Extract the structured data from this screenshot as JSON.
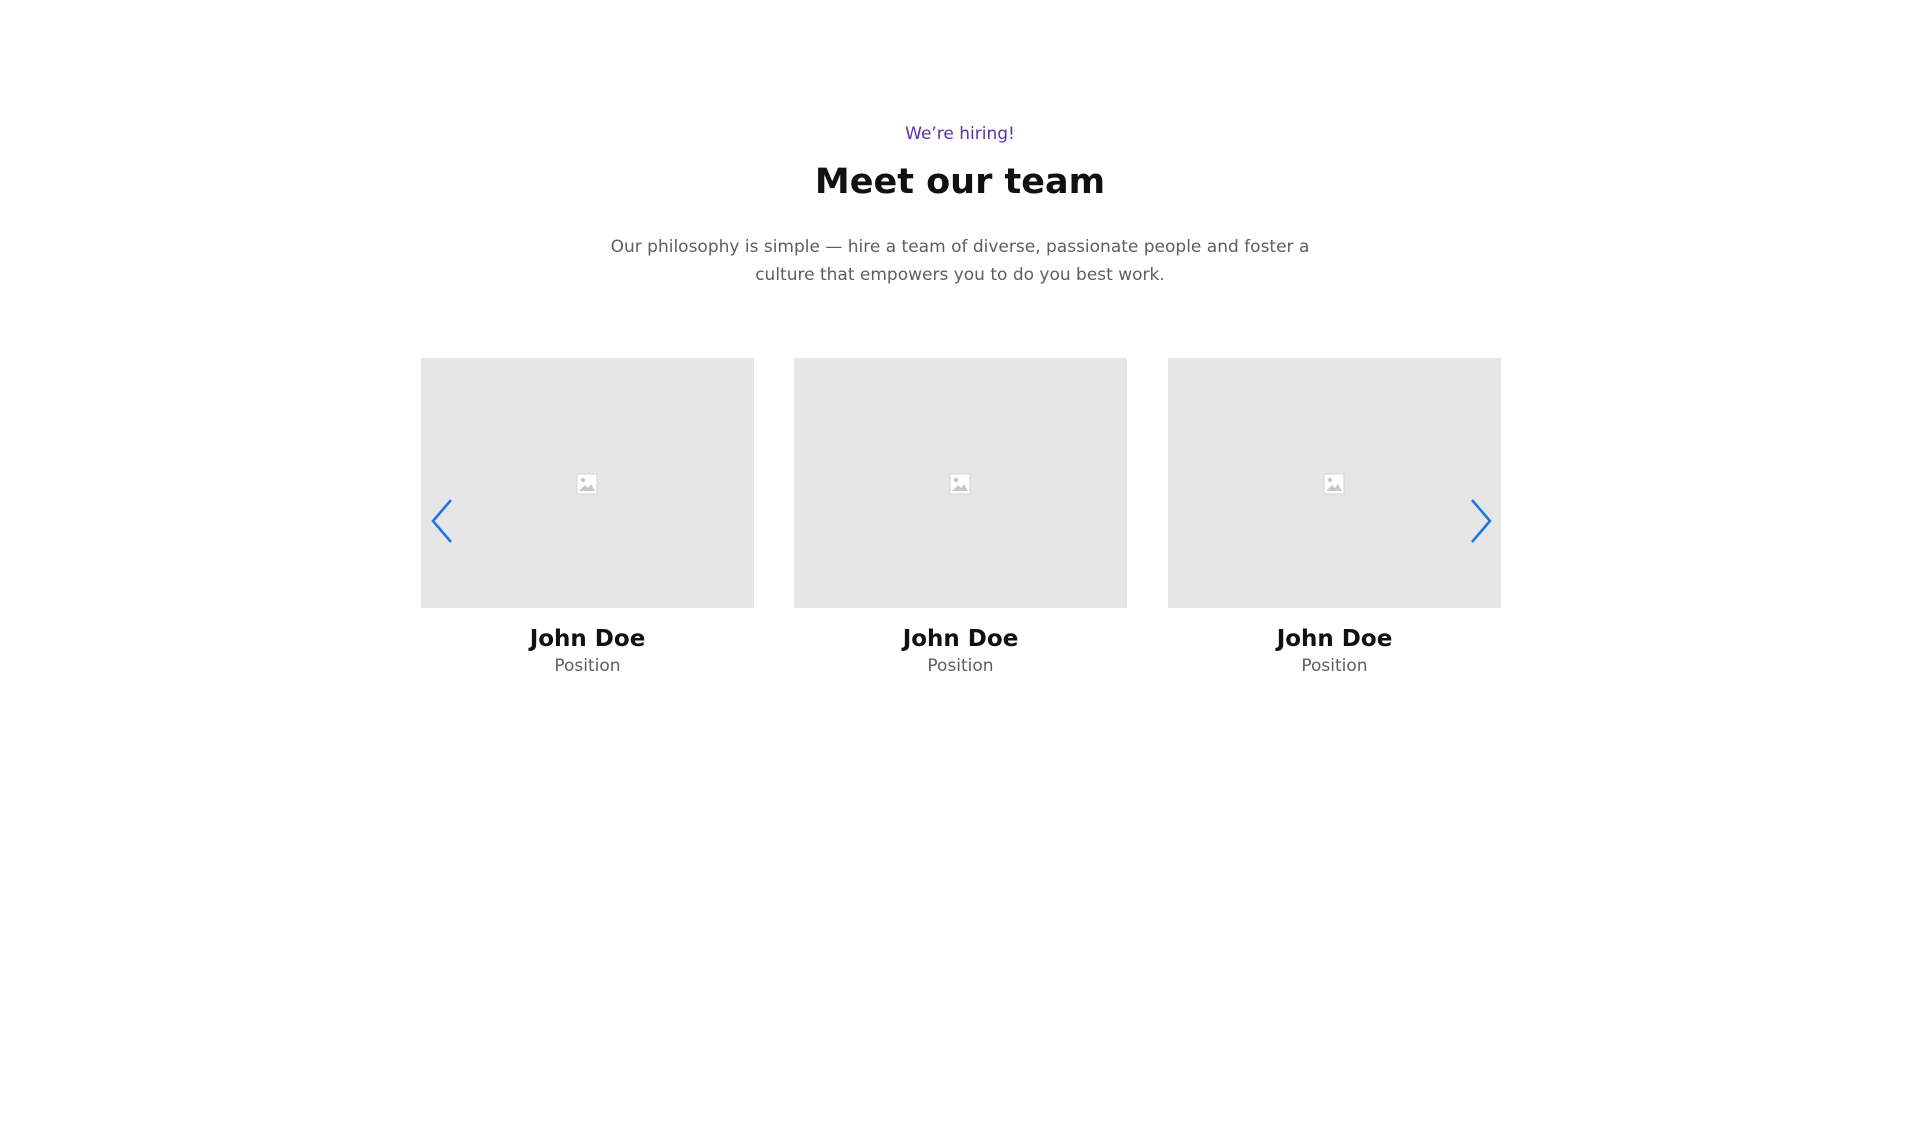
{
  "team_section": {
    "eyebrow": "We’re hiring!",
    "title": "Meet our team",
    "intro": "Our philosophy is simple — hire a team of diverse, passionate people and foster a culture that empowers you to do you best work.",
    "accent_color": "#5b32a8",
    "arrow_color": "#1a73e8",
    "image_placeholder_color": "#e6e6e6"
  },
  "carousel": {
    "prev_icon": "chevron-left-icon",
    "next_icon": "chevron-right-icon",
    "members": [
      {
        "name": "John Doe",
        "position": "Position",
        "photo_icon": "image-placeholder-icon"
      },
      {
        "name": "John Doe",
        "position": "Position",
        "photo_icon": "image-placeholder-icon"
      },
      {
        "name": "John Doe",
        "position": "Position",
        "photo_icon": "image-placeholder-icon"
      }
    ]
  }
}
